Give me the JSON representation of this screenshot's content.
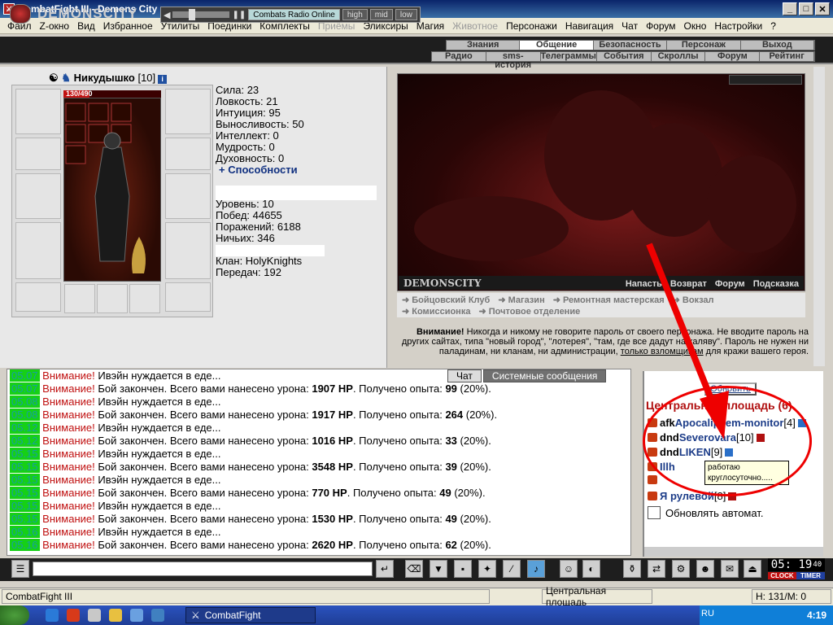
{
  "window": {
    "title": "CombatFight III - Demons City",
    "min_label": "_",
    "max_label": "□",
    "close_label": "✕"
  },
  "menu": [
    {
      "label": "Файл",
      "disabled": false
    },
    {
      "label": "Z-окно",
      "disabled": false
    },
    {
      "label": "Вид",
      "disabled": false
    },
    {
      "label": "Избранное",
      "disabled": false
    },
    {
      "label": "Утилиты",
      "disabled": false
    },
    {
      "label": "Поединки",
      "disabled": false
    },
    {
      "label": "Комплекты",
      "disabled": false
    },
    {
      "label": "Приёмы",
      "disabled": true
    },
    {
      "label": "Эликсиры",
      "disabled": false
    },
    {
      "label": "Магия",
      "disabled": false
    },
    {
      "label": "Животное",
      "disabled": true
    },
    {
      "label": "Персонажи",
      "disabled": false
    },
    {
      "label": "Навигация",
      "disabled": false
    },
    {
      "label": "Чат",
      "disabled": false
    },
    {
      "label": "Форум",
      "disabled": false
    },
    {
      "label": "Окно",
      "disabled": false
    },
    {
      "label": "Настройки",
      "disabled": false
    },
    {
      "label": "?",
      "disabled": false
    }
  ],
  "header": {
    "logo": "DEMONSCITY",
    "radio": {
      "station": "Combats Radio Online",
      "high": "high",
      "mid": "mid",
      "low": "low"
    },
    "nav_top": [
      "Знания",
      "Общение",
      "Безопасность",
      "Персонаж",
      "Выход"
    ],
    "nav_top_active": "Общение",
    "nav_bottom": [
      "Радио",
      "sms-история",
      "Телеграммы",
      "События",
      "Скроллы",
      "Форум",
      "Рейтинг"
    ]
  },
  "character": {
    "name": "Никудышко",
    "level": "[10]",
    "info_icon": "i",
    "hp_text": "130/490",
    "hp_fraction": 0.265,
    "stats": [
      "Сила: 23",
      "Ловкость: 21",
      "Интуиция: 95",
      "Выносливость: 50",
      "Интеллект: 0",
      "Мудрость: 0",
      "Духовность: 0"
    ],
    "abilities": "+ Способности",
    "stats2": [
      "Уровень: 10",
      "Побед: 44655",
      "Поражений: 6188",
      "Ничьих: 346"
    ],
    "stats3": [
      "Клан: HolyKnights",
      "Передач: 192"
    ]
  },
  "scene": {
    "name": "DEMONSCITY",
    "links": [
      "Напасть",
      "Возврат",
      "Форум",
      "Подсказка"
    ]
  },
  "locations": {
    "row1": [
      "➜ Бойцовский Клуб",
      "➜ Магазин",
      "➜ Ремонтная мастерская",
      "➜ Вокзал"
    ],
    "row2": [
      "➜ Комиссионка",
      "➜ Почтовое отделение"
    ]
  },
  "warning": {
    "label": "Внимание!",
    "text": " Никогда и никому не говорите пароль от своего персонажа. Не вводите пароль на других сайтах, типа \"новый город\", \"лотерея\", \"там, где все дадут на халяву\". Пароль не нужен ни паладинам, ни кланам, ни администрации, ",
    "link": "только взломщикам",
    "tail": " для кражи вашего героя."
  },
  "chat": {
    "tabs": [
      "Чат",
      "Системные сообщения"
    ],
    "messages": [
      {
        "time": "05.07",
        "warn": "Внимание!",
        "text": " Ивэйн нуждается в еде...",
        "dmg": "",
        "xp": "",
        "pct": ""
      },
      {
        "time": "05.07",
        "warn": "Внимание!",
        "text": " Бой закончен. Всего вами нанесено урона: ",
        "dmg": "1907 HP",
        "xp": "99",
        "pct": "(20%)."
      },
      {
        "time": "05.08",
        "warn": "Внимание!",
        "text": " Ивэйн нуждается в еде...",
        "dmg": "",
        "xp": "",
        "pct": ""
      },
      {
        "time": "05.08",
        "warn": "Внимание!",
        "text": " Бой закончен. Всего вами нанесено урона: ",
        "dmg": "1917 HP",
        "xp": "264",
        "pct": "(20%)."
      },
      {
        "time": "05.12",
        "warn": "Внимание!",
        "text": " Ивэйн нуждается в еде...",
        "dmg": "",
        "xp": "",
        "pct": ""
      },
      {
        "time": "05.12",
        "warn": "Внимание!",
        "text": " Бой закончен. Всего вами нанесено урона: ",
        "dmg": "1016 HP",
        "xp": "33",
        "pct": "(20%)."
      },
      {
        "time": "05.15",
        "warn": "Внимание!",
        "text": " Ивэйн нуждается в еде...",
        "dmg": "",
        "xp": "",
        "pct": ""
      },
      {
        "time": "05.15",
        "warn": "Внимание!",
        "text": " Бой закончен. Всего вами нанесено урона: ",
        "dmg": "3548 HP",
        "xp": "39",
        "pct": "(20%)."
      },
      {
        "time": "05.15",
        "warn": "Внимание!",
        "text": " Ивэйн нуждается в еде...",
        "dmg": "",
        "xp": "",
        "pct": ""
      },
      {
        "time": "05.15",
        "warn": "Внимание!",
        "text": " Бой закончен. Всего вами нанесено урона: ",
        "dmg": "770 HP",
        "xp": "49",
        "pct": "(20%)."
      },
      {
        "time": "05.15",
        "warn": "Внимание!",
        "text": " Ивэйн нуждается в еде...",
        "dmg": "",
        "xp": "",
        "pct": ""
      },
      {
        "time": "05.15",
        "warn": "Внимание!",
        "text": " Бой закончен. Всего вами нанесено урона: ",
        "dmg": "1530 HP",
        "xp": "49",
        "pct": "(20%)."
      },
      {
        "time": "05.16",
        "warn": "Внимание!",
        "text": " Ивэйн нуждается в еде...",
        "dmg": "",
        "xp": "",
        "pct": ""
      },
      {
        "time": "05.16",
        "warn": "Внимание!",
        "text": " Бой закончен. Всего вами нанесено урона: ",
        "dmg": "2620 HP",
        "xp": "62",
        "pct": "(20%)."
      }
    ],
    "xp_label": ". Получено опыта: "
  },
  "room": {
    "refresh": "Обновить",
    "title": "Центральная площадь (6)",
    "users": [
      {
        "prefix": "afk ",
        "name": "Apocalipsem-monitor",
        "level": "[4]"
      },
      {
        "prefix": "dnd ",
        "name": "Severovara",
        "level": "[10]"
      },
      {
        "prefix": "dnd ",
        "name": "LIKEN",
        "level": "[9]"
      },
      {
        "prefix": "",
        "name": "Illh",
        "level": ""
      },
      {
        "prefix": "",
        "name": "",
        "level": ""
      },
      {
        "prefix": "",
        "name": "Я рулевой",
        "level": "[8]"
      }
    ],
    "tooltip": "работаю круглосуточно.....",
    "auto_refresh": "Обновлять автомат."
  },
  "clock": {
    "time": "05: 19",
    "seconds": "40",
    "clock_label": "CLOCK",
    "timer_label": "TIMER"
  },
  "status": {
    "app": "CombatFight III",
    "location": "Центральная площадь",
    "hp": "H: 131/M: 0"
  },
  "taskbar": {
    "button": "CombatFight",
    "lang": "RU",
    "time": "4:19"
  },
  "colors": {
    "time_bg": "#16d016",
    "warn": "#c01010",
    "room_title": "#b01010",
    "highlight": "#e00000"
  }
}
